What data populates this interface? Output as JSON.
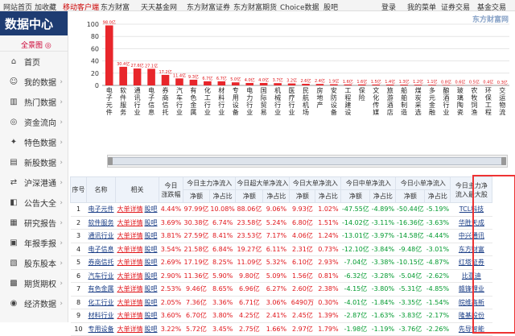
{
  "topbar": {
    "items": [
      "网站首页",
      "加收藏",
      "移动客户端",
      "东方财富",
      "天天基金网",
      "东方财富证券",
      "东方财富期货",
      "Choice数据",
      "股吧"
    ],
    "right_items": [
      "登录",
      "我的菜单",
      "证券交易",
      "基金交易"
    ]
  },
  "sidebar": {
    "title": "数据中心",
    "subtitle": "全景图",
    "items": [
      {
        "label": "首页",
        "icon": "home-icon",
        "glyph": "⌂"
      },
      {
        "label": "我的数据",
        "icon": "person-icon",
        "glyph": "☺"
      },
      {
        "label": "热门数据",
        "icon": "chart-icon",
        "glyph": "▥"
      },
      {
        "label": "资金流向",
        "icon": "money-icon",
        "glyph": "◎"
      },
      {
        "label": "特色数据",
        "icon": "star-icon",
        "glyph": "✦"
      },
      {
        "label": "新股数据",
        "icon": "new-icon",
        "glyph": "▤"
      },
      {
        "label": "沪深港通",
        "icon": "exchange-icon",
        "glyph": "⇄"
      },
      {
        "label": "公告大全",
        "icon": "megaphone-icon",
        "glyph": "◧"
      },
      {
        "label": "研究报告",
        "icon": "report-icon",
        "glyph": "▦"
      },
      {
        "label": "年报季报",
        "icon": "document-icon",
        "glyph": "▣"
      },
      {
        "label": "股东股本",
        "icon": "shareholder-icon",
        "glyph": "▧"
      },
      {
        "label": "期货期权",
        "icon": "futures-icon",
        "glyph": "▩"
      },
      {
        "label": "经济数据",
        "icon": "economy-icon",
        "glyph": "◉"
      }
    ]
  },
  "brand": {
    "logo": "东方财富网",
    "accent": "#e0161b",
    "nav": "#1e3c72"
  },
  "chart_data": {
    "type": "bar",
    "categories": [
      "电子元件",
      "软件服务",
      "通讯行业",
      "电子信息",
      "券商信托",
      "汽车行业",
      "有色金属",
      "化工行业",
      "材料行业",
      "专用设备",
      "电力行业",
      "国际贸易",
      "机械行业",
      "医疗行业",
      "民航机场",
      "房地产",
      "安防设备",
      "工程建设",
      "保险",
      "文化传媒",
      "旅游酒店",
      "船舶制造",
      "煤炭采选",
      "多元金融",
      "酿酒行业",
      "玻璃陶瓷",
      "农牧饲渔",
      "环保工程",
      "交运物流"
    ],
    "values": [
      98.0,
      30.4,
      27.6,
      27.1,
      17.2,
      11.4,
      9.3,
      6.7,
      6.7,
      5.0,
      4.0,
      4.0,
      3.7,
      3.2,
      2.6,
      2.4,
      1.9,
      1.6,
      1.6,
      1.5,
      1.4,
      1.3,
      1.2,
      1.1,
      0.8,
      0.6,
      0.5,
      0.4,
      0.3
    ],
    "labels": [
      "98.0亿",
      "30.4亿",
      "27.6亿",
      "27.1亿",
      "17.2亿",
      "11.4亿",
      "9.3亿",
      "6.7亿",
      "6.7亿",
      "5.0亿",
      "4.0亿",
      "4.0亿",
      "3.7亿",
      "3.2亿",
      "2.6亿",
      "2.4亿",
      "1.9亿",
      "1.6亿",
      "1.6亿",
      "1.5亿",
      "1.4亿",
      "1.3亿",
      "1.2亿",
      "1.1亿",
      "0.8亿",
      "0.6亿",
      "0.5亿",
      "0.4亿",
      "0.3亿"
    ],
    "yticks": [
      "100",
      "80",
      "60",
      "40",
      "20",
      "0"
    ],
    "ylim": [
      0,
      100
    ],
    "bar_color": "#e8262b",
    "title": "",
    "xlabel": "",
    "ylabel": ""
  },
  "table": {
    "headers": {
      "idx": "序号",
      "name": "名称",
      "related": "相关",
      "chg_a": "今日",
      "chg_b": "涨跌幅",
      "main": "今日主力净流入",
      "super": "今日超大单净流入",
      "large": "今日大单净流入",
      "mid": "今日中单净流入",
      "small": "今日小单净流入",
      "top_a": "今日主力净",
      "top_b": "流入最大股",
      "amount": "净额",
      "ratio": "净占比"
    },
    "action_labels": {
      "detail": "大单详情",
      "guba": "股吧"
    },
    "rows": [
      {
        "idx": "1",
        "name": "电子元件",
        "chg": "4.44%",
        "main_amt": "97.99亿",
        "main_pct": "10.08%",
        "sup_amt": "88.06亿",
        "sup_pct": "9.06%",
        "lg_amt": "9.93亿",
        "lg_pct": "1.02%",
        "md_amt": "-47.55亿",
        "md_pct": "-4.89%",
        "sm_amt": "-50.44亿",
        "sm_pct": "-5.19%",
        "top": "TCL科技"
      },
      {
        "idx": "2",
        "name": "软件服务",
        "chg": "3.69%",
        "main_amt": "30.38亿",
        "main_pct": "6.74%",
        "sup_amt": "23.58亿",
        "sup_pct": "5.24%",
        "lg_amt": "6.80亿",
        "lg_pct": "1.51%",
        "md_amt": "-14.02亿",
        "md_pct": "-3.11%",
        "sm_amt": "-16.36亿",
        "sm_pct": "-3.63%",
        "top": "华胜天成"
      },
      {
        "idx": "3",
        "name": "通讯行业",
        "chg": "3.81%",
        "main_amt": "27.59亿",
        "main_pct": "8.41%",
        "sup_amt": "23.53亿",
        "sup_pct": "7.17%",
        "lg_amt": "4.06亿",
        "lg_pct": "1.24%",
        "md_amt": "-13.01亿",
        "md_pct": "-3.97%",
        "sm_amt": "-14.58亿",
        "sm_pct": "-4.44%",
        "top": "中兴通讯"
      },
      {
        "idx": "4",
        "name": "电子信息",
        "chg": "3.54%",
        "main_amt": "21.58亿",
        "main_pct": "6.84%",
        "sup_amt": "19.27亿",
        "sup_pct": "6.11%",
        "lg_amt": "2.31亿",
        "lg_pct": "0.73%",
        "md_amt": "-12.10亿",
        "md_pct": "-3.84%",
        "sm_amt": "-9.48亿",
        "sm_pct": "-3.01%",
        "top": "东方财富"
      },
      {
        "idx": "5",
        "name": "券商信托",
        "chg": "2.69%",
        "main_amt": "17.19亿",
        "main_pct": "8.25%",
        "sup_amt": "11.09亿",
        "sup_pct": "5.32%",
        "lg_amt": "6.10亿",
        "lg_pct": "2.93%",
        "md_amt": "-7.04亿",
        "md_pct": "-3.38%",
        "sm_amt": "-10.15亿",
        "sm_pct": "-4.87%",
        "top": "红塔证券"
      },
      {
        "idx": "6",
        "name": "汽车行业",
        "chg": "2.90%",
        "main_amt": "11.36亿",
        "main_pct": "5.90%",
        "sup_amt": "9.80亿",
        "sup_pct": "5.09%",
        "lg_amt": "1.56亿",
        "lg_pct": "0.81%",
        "md_amt": "-6.32亿",
        "md_pct": "-3.28%",
        "sm_amt": "-5.04亿",
        "sm_pct": "-2.62%",
        "top": "比亚迪"
      },
      {
        "idx": "7",
        "name": "有色金属",
        "chg": "2.53%",
        "main_amt": "9.46亿",
        "main_pct": "8.65%",
        "sup_amt": "6.96亿",
        "sup_pct": "6.27%",
        "lg_amt": "2.60亿",
        "lg_pct": "2.38%",
        "md_amt": "-4.15亿",
        "md_pct": "-3.80%",
        "sm_amt": "-5.31亿",
        "sm_pct": "-4.85%",
        "top": "赣锋锂业"
      },
      {
        "idx": "8",
        "name": "化工行业",
        "chg": "2.05%",
        "main_amt": "7.36亿",
        "main_pct": "3.36%",
        "sup_amt": "6.71亿",
        "sup_pct": "3.06%",
        "lg_amt": "6490万",
        "lg_pct": "0.30%",
        "md_amt": "-4.01亿",
        "md_pct": "-1.84%",
        "sm_amt": "-3.35亿",
        "sm_pct": "-1.54%",
        "top": "皖维高新"
      },
      {
        "idx": "9",
        "name": "材料行业",
        "chg": "3.60%",
        "main_amt": "6.70亿",
        "main_pct": "3.80%",
        "sup_amt": "4.25亿",
        "sup_pct": "2.41%",
        "lg_amt": "2.45亿",
        "lg_pct": "1.39%",
        "md_amt": "-2.87亿",
        "md_pct": "-1.63%",
        "sm_amt": "-3.83亿",
        "sm_pct": "-2.17%",
        "top": "隆基股份"
      },
      {
        "idx": "10",
        "name": "专用设备",
        "chg": "3.22%",
        "main_amt": "5.72亿",
        "main_pct": "3.45%",
        "sup_amt": "2.75亿",
        "sup_pct": "1.66%",
        "lg_amt": "2.97亿",
        "lg_pct": "1.79%",
        "md_amt": "-1.98亿",
        "md_pct": "-1.19%",
        "sm_amt": "-3.76亿",
        "sm_pct": "-2.26%",
        "top": "先导智能"
      }
    ]
  }
}
